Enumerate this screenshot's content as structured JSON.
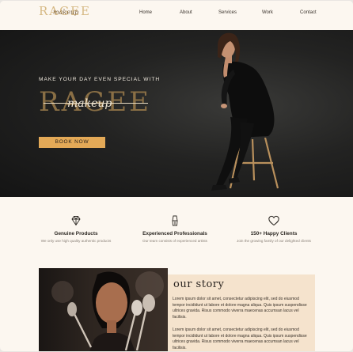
{
  "brand": {
    "main": "RAGEE",
    "script": "makeup"
  },
  "nav": {
    "items": [
      "Home",
      "About",
      "Services",
      "Work",
      "Contact"
    ]
  },
  "hero": {
    "tagline": "MAKE YOUR DAY EVEN SPECIAL WITH",
    "brand_main": "RAGEE",
    "brand_script": "makeup",
    "cta": "BOOK NOW"
  },
  "features": [
    {
      "icon": "diamond-icon",
      "title": "Genuine Products",
      "desc": "We only use high quality authentic products"
    },
    {
      "icon": "makeup-brush-icon",
      "title": "Experienced Professionals",
      "desc": "Our team consists of experienced artists"
    },
    {
      "icon": "heart-icon",
      "title": "150+ Happy Clients",
      "desc": "Join the growing family of our delighted clients"
    }
  ],
  "story": {
    "title": "our story",
    "p1": "Lorem ipsum dolor sit amet, consectetur adipiscing elit, sed do eiusmod tempor incididunt ut labore et dolore magna aliqua. Quis ipsum suspendisse ultrices gravida. Risus commodo viverra maecenas accumsan lacus vel facilisis.",
    "p2": "Lorem ipsum dolor sit amet, consectetur adipiscing elit, sed do eiusmod tempor incididunt ut labore et dolore magna aliqua. Quis ipsum suspendisse ultrices gravida. Risus commodo viverra maecenas accumsan lacus vel facilisis."
  },
  "colors": {
    "accent": "#e3a957",
    "gold": "#d6b985",
    "cream": "#fcf7f0",
    "story_bg": "#f5e3cd",
    "hero_bg": "#1c1c1b"
  }
}
